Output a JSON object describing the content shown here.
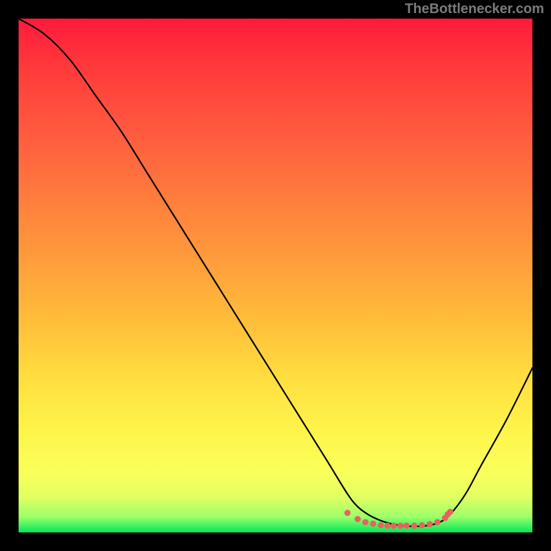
{
  "attribution": "TheBottlenecker.com",
  "chart_data": {
    "type": "line",
    "title": "",
    "xlabel": "",
    "ylabel": "",
    "xlim": [
      0,
      1
    ],
    "ylim": [
      0,
      1
    ],
    "series": [
      {
        "name": "curve",
        "x": [
          0.0,
          0.05,
          0.1,
          0.15,
          0.2,
          0.25,
          0.3,
          0.35,
          0.4,
          0.45,
          0.5,
          0.55,
          0.6,
          0.64,
          0.66,
          0.68,
          0.7,
          0.72,
          0.74,
          0.76,
          0.78,
          0.8,
          0.82,
          0.84,
          0.87,
          0.9,
          0.95,
          1.0
        ],
        "y": [
          1.0,
          0.97,
          0.92,
          0.85,
          0.78,
          0.7,
          0.62,
          0.54,
          0.46,
          0.38,
          0.3,
          0.22,
          0.14,
          0.075,
          0.05,
          0.035,
          0.025,
          0.018,
          0.014,
          0.012,
          0.012,
          0.014,
          0.02,
          0.035,
          0.075,
          0.13,
          0.22,
          0.32
        ]
      }
    ],
    "markers": {
      "name": "bottom-dots",
      "x": [
        0.64,
        0.66,
        0.675,
        0.69,
        0.705,
        0.718,
        0.73,
        0.743,
        0.755,
        0.77,
        0.785,
        0.8,
        0.815,
        0.83,
        0.835,
        0.84
      ],
      "y": [
        0.038,
        0.026,
        0.02,
        0.017,
        0.014,
        0.013,
        0.013,
        0.013,
        0.013,
        0.013,
        0.014,
        0.016,
        0.02,
        0.028,
        0.035,
        0.04
      ]
    }
  }
}
